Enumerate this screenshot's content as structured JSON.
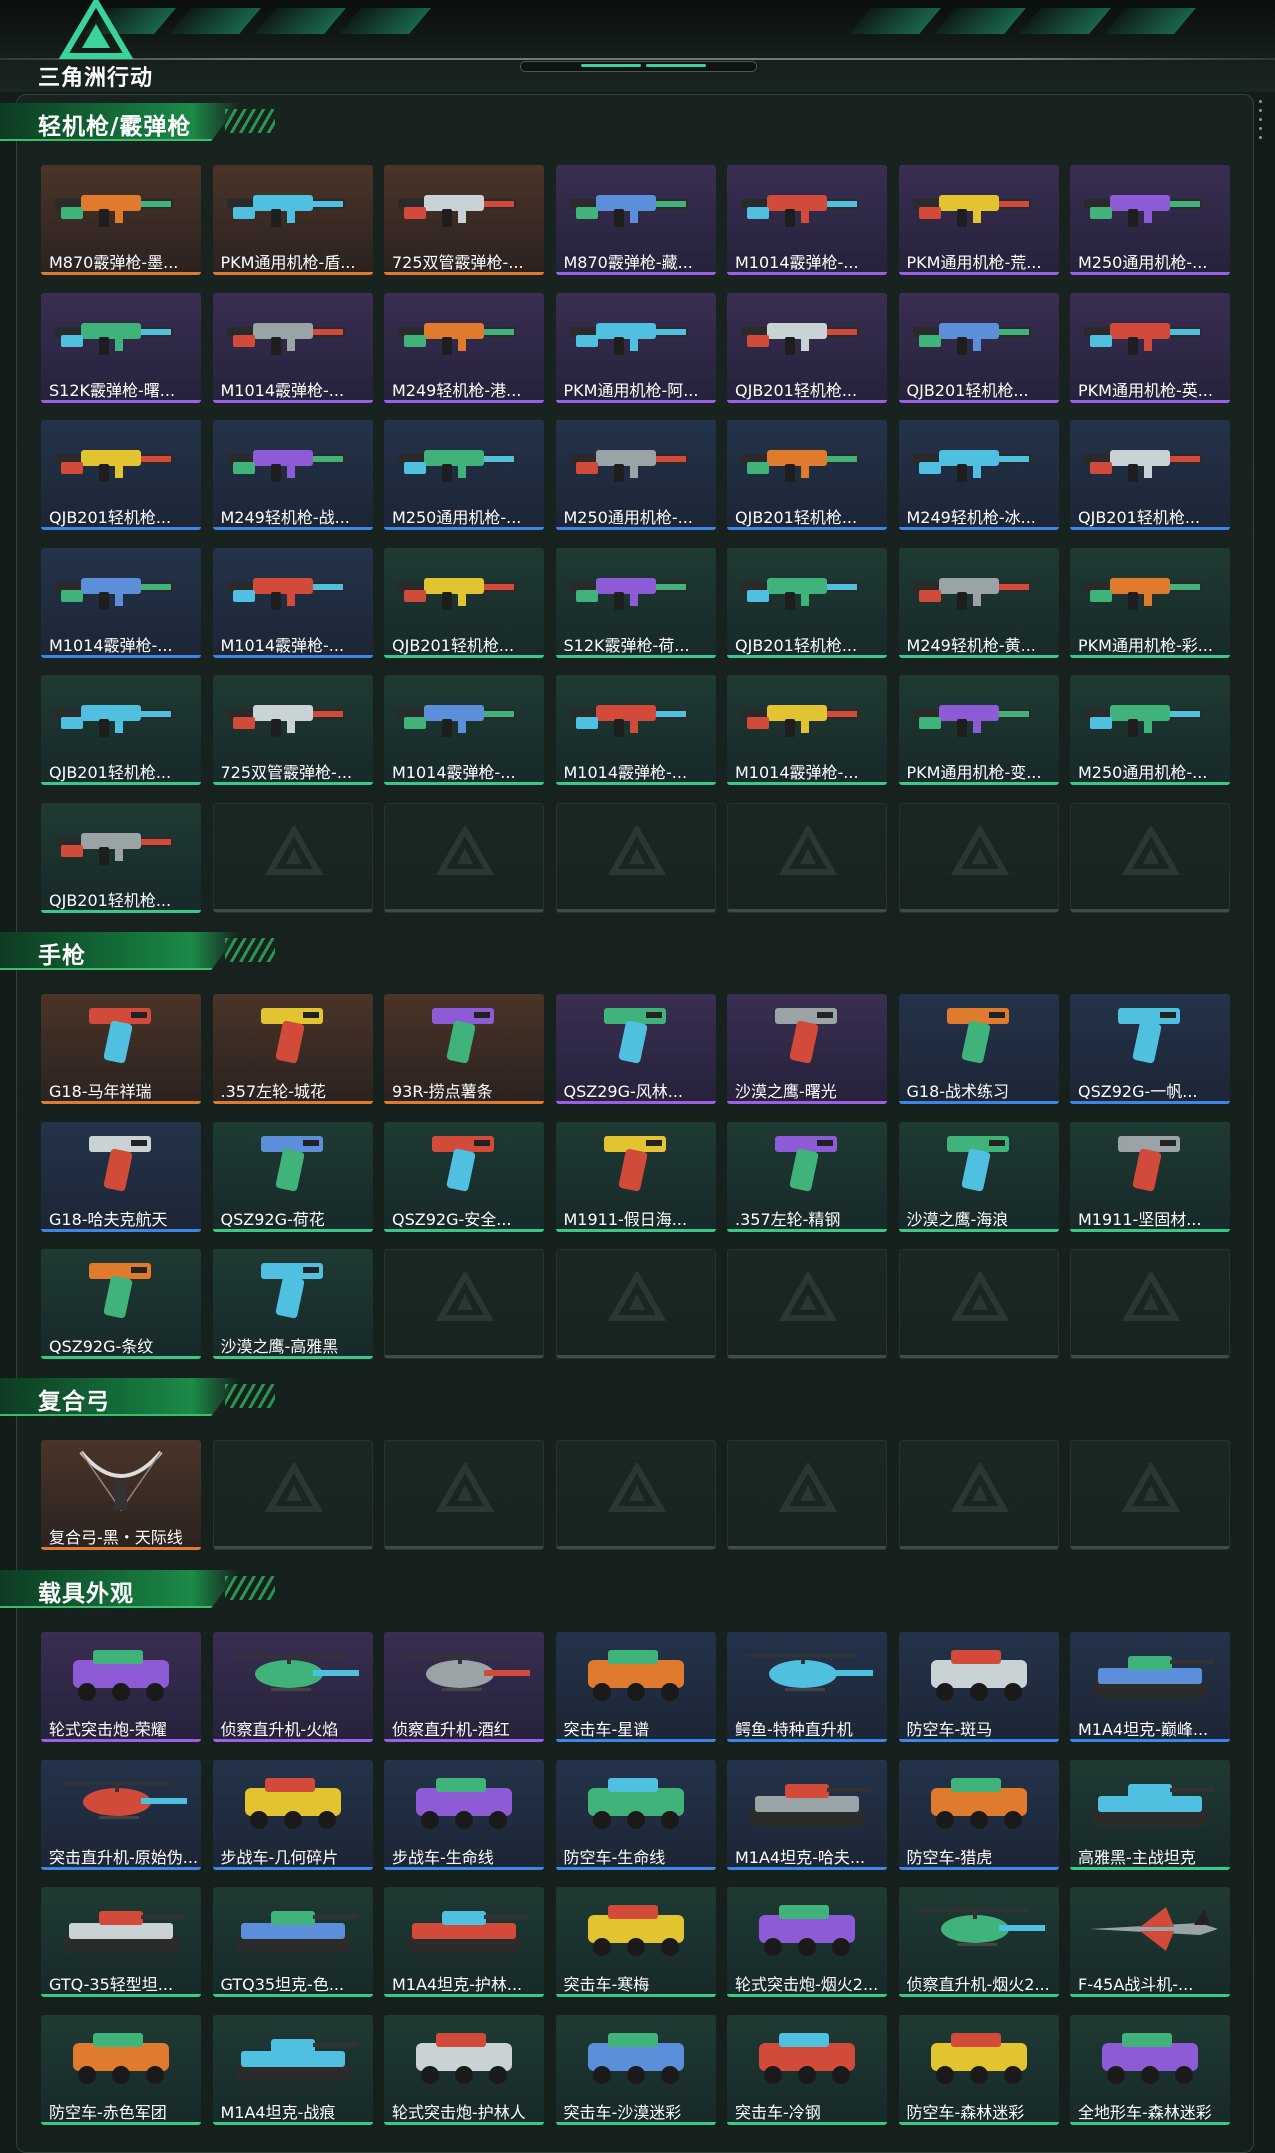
{
  "header": {
    "title": "三角洲行动"
  },
  "sections": [
    {
      "title": "轻机枪/霰弹枪",
      "items": [
        {
          "label": "M870霰弹枪-墨...",
          "rarity": "orange",
          "kind": "gun"
        },
        {
          "label": "PKM通用机枪-盾...",
          "rarity": "orange",
          "kind": "gun"
        },
        {
          "label": "725双管霰弹枪-...",
          "rarity": "orange",
          "kind": "gun"
        },
        {
          "label": "M870霰弹枪-藏...",
          "rarity": "purple",
          "kind": "gun"
        },
        {
          "label": "M1014霰弹枪-...",
          "rarity": "purple",
          "kind": "gun"
        },
        {
          "label": "PKM通用机枪-荒...",
          "rarity": "purple",
          "kind": "gun"
        },
        {
          "label": "M250通用机枪-...",
          "rarity": "purple",
          "kind": "gun"
        },
        {
          "label": "S12K霰弹枪-曙...",
          "rarity": "purple",
          "kind": "gun"
        },
        {
          "label": "M1014霰弹枪-...",
          "rarity": "purple",
          "kind": "gun"
        },
        {
          "label": "M249轻机枪-港...",
          "rarity": "purple",
          "kind": "gun"
        },
        {
          "label": "PKM通用机枪-阿...",
          "rarity": "purple",
          "kind": "gun"
        },
        {
          "label": "QJB201轻机枪...",
          "rarity": "purple",
          "kind": "gun"
        },
        {
          "label": "QJB201轻机枪...",
          "rarity": "purple",
          "kind": "gun"
        },
        {
          "label": "PKM通用机枪-英...",
          "rarity": "purple",
          "kind": "gun"
        },
        {
          "label": "QJB201轻机枪...",
          "rarity": "blue",
          "kind": "gun"
        },
        {
          "label": "M249轻机枪-战...",
          "rarity": "blue",
          "kind": "gun"
        },
        {
          "label": "M250通用机枪-...",
          "rarity": "blue",
          "kind": "gun"
        },
        {
          "label": "M250通用机枪-...",
          "rarity": "blue",
          "kind": "gun"
        },
        {
          "label": "QJB201轻机枪...",
          "rarity": "blue",
          "kind": "gun"
        },
        {
          "label": "M249轻机枪-冰...",
          "rarity": "blue",
          "kind": "gun"
        },
        {
          "label": "QJB201轻机枪...",
          "rarity": "blue",
          "kind": "gun"
        },
        {
          "label": "M1014霰弹枪-...",
          "rarity": "blue",
          "kind": "gun"
        },
        {
          "label": "M1014霰弹枪-...",
          "rarity": "blue",
          "kind": "gun"
        },
        {
          "label": "QJB201轻机枪...",
          "rarity": "green",
          "kind": "gun"
        },
        {
          "label": "S12K霰弹枪-荷...",
          "rarity": "green",
          "kind": "gun"
        },
        {
          "label": "QJB201轻机枪...",
          "rarity": "green",
          "kind": "gun"
        },
        {
          "label": "M249轻机枪-黄...",
          "rarity": "green",
          "kind": "gun"
        },
        {
          "label": "PKM通用机枪-彩...",
          "rarity": "green",
          "kind": "gun"
        },
        {
          "label": "QJB201轻机枪...",
          "rarity": "green",
          "kind": "gun"
        },
        {
          "label": "725双管霰弹枪-...",
          "rarity": "green",
          "kind": "gun"
        },
        {
          "label": "M1014霰弹枪-...",
          "rarity": "green",
          "kind": "gun"
        },
        {
          "label": "M1014霰弹枪-...",
          "rarity": "green",
          "kind": "gun"
        },
        {
          "label": "M1014霰弹枪-...",
          "rarity": "green",
          "kind": "gun"
        },
        {
          "label": "PKM通用机枪-变...",
          "rarity": "green",
          "kind": "gun"
        },
        {
          "label": "M250通用机枪-...",
          "rarity": "green",
          "kind": "gun"
        },
        {
          "label": "QJB201轻机枪...",
          "rarity": "green",
          "kind": "gun"
        }
      ]
    },
    {
      "title": "手枪",
      "items": [
        {
          "label": "G18-马年祥瑞",
          "rarity": "orange",
          "kind": "pistol"
        },
        {
          "label": ".357左轮-城花",
          "rarity": "orange",
          "kind": "pistol"
        },
        {
          "label": "93R-捞点薯条",
          "rarity": "orange",
          "kind": "pistol"
        },
        {
          "label": "QSZ29G-风林...",
          "rarity": "purple",
          "kind": "pistol"
        },
        {
          "label": "沙漠之鹰-曙光",
          "rarity": "purple",
          "kind": "pistol"
        },
        {
          "label": "G18-战术练习",
          "rarity": "blue",
          "kind": "pistol"
        },
        {
          "label": "QSZ92G-一帆...",
          "rarity": "blue",
          "kind": "pistol"
        },
        {
          "label": "G18-哈夫克航天",
          "rarity": "blue",
          "kind": "pistol"
        },
        {
          "label": "QSZ92G-荷花",
          "rarity": "green",
          "kind": "pistol"
        },
        {
          "label": "QSZ92G-安全...",
          "rarity": "green",
          "kind": "pistol"
        },
        {
          "label": "M1911-假日海...",
          "rarity": "green",
          "kind": "pistol"
        },
        {
          "label": ".357左轮-精钢",
          "rarity": "green",
          "kind": "pistol"
        },
        {
          "label": "沙漠之鹰-海浪",
          "rarity": "green",
          "kind": "pistol"
        },
        {
          "label": "M1911-坚固材...",
          "rarity": "green",
          "kind": "pistol"
        },
        {
          "label": "QSZ92G-条纹",
          "rarity": "green",
          "kind": "pistol"
        },
        {
          "label": "沙漠之鹰-高雅黑",
          "rarity": "green",
          "kind": "pistol"
        }
      ]
    },
    {
      "title": "复合弓",
      "items": [
        {
          "label": "复合弓-黑・天际线",
          "rarity": "orange",
          "kind": "bow"
        }
      ]
    },
    {
      "title": "载具外观",
      "items": [
        {
          "label": "轮式突击炮-荣耀",
          "rarity": "purple",
          "kind": "vehicle"
        },
        {
          "label": "侦察直升机-火焰",
          "rarity": "purple",
          "kind": "heli"
        },
        {
          "label": "侦察直升机-酒红",
          "rarity": "purple",
          "kind": "heli"
        },
        {
          "label": "突击车-星谱",
          "rarity": "blue",
          "kind": "vehicle"
        },
        {
          "label": "鳄鱼-特种直升机",
          "rarity": "blue",
          "kind": "heli"
        },
        {
          "label": "防空车-斑马",
          "rarity": "blue",
          "kind": "vehicle"
        },
        {
          "label": "M1A4坦克-巅峰...",
          "rarity": "blue",
          "kind": "tank"
        },
        {
          "label": "突击直升机-原始伪...",
          "rarity": "blue",
          "kind": "heli"
        },
        {
          "label": "步战车-几何碎片",
          "rarity": "blue",
          "kind": "vehicle"
        },
        {
          "label": "步战车-生命线",
          "rarity": "blue",
          "kind": "vehicle"
        },
        {
          "label": "防空车-生命线",
          "rarity": "blue",
          "kind": "vehicle"
        },
        {
          "label": "M1A4坦克-哈夫...",
          "rarity": "blue",
          "kind": "tank"
        },
        {
          "label": "防空车-猎虎",
          "rarity": "blue",
          "kind": "vehicle"
        },
        {
          "label": "高雅黑-主战坦克",
          "rarity": "green",
          "kind": "tank"
        },
        {
          "label": "GTQ-35轻型坦...",
          "rarity": "green",
          "kind": "tank"
        },
        {
          "label": "GTQ35坦克-色...",
          "rarity": "green",
          "kind": "tank"
        },
        {
          "label": "M1A4坦克-护林...",
          "rarity": "green",
          "kind": "tank"
        },
        {
          "label": "突击车-寒梅",
          "rarity": "green",
          "kind": "vehicle"
        },
        {
          "label": "轮式突击炮-烟火2...",
          "rarity": "green",
          "kind": "vehicle"
        },
        {
          "label": "侦察直升机-烟火2...",
          "rarity": "green",
          "kind": "heli"
        },
        {
          "label": "F-45A战斗机-...",
          "rarity": "green",
          "kind": "jet"
        },
        {
          "label": "防空车-赤色军团",
          "rarity": "green",
          "kind": "vehicle"
        },
        {
          "label": "M1A4坦克-战痕",
          "rarity": "green",
          "kind": "tank"
        },
        {
          "label": "轮式突击炮-护林人",
          "rarity": "green",
          "kind": "vehicle"
        },
        {
          "label": "突击车-沙漠迷彩",
          "rarity": "green",
          "kind": "vehicle"
        },
        {
          "label": "突击车-冷钢",
          "rarity": "green",
          "kind": "vehicle"
        },
        {
          "label": "防空车-森林迷彩",
          "rarity": "green",
          "kind": "vehicle"
        },
        {
          "label": "全地形车-森林迷彩",
          "rarity": "green",
          "kind": "vehicle"
        }
      ]
    }
  ],
  "colors": {
    "orange": "#e07a2c",
    "purple": "#9b5fe8",
    "blue": "#3d86e8",
    "green": "#38c98a",
    "accent": "#1c8a49"
  }
}
